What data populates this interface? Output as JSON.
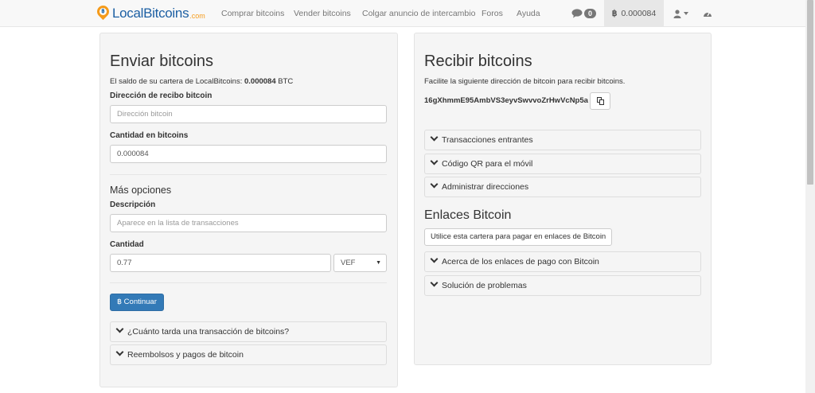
{
  "navbar": {
    "brand_name": "LocalBitcoins",
    "brand_tld": ".com",
    "links": [
      "Comprar bitcoins",
      "Vender bitcoins",
      "Colgar anuncio de intercambio",
      "Foros",
      "Ayuda"
    ],
    "chat_count": "0",
    "balance_symbol": "฿",
    "balance": "0.000084"
  },
  "send": {
    "title": "Enviar bitcoins",
    "balance_prefix": "El saldo de su cartera de LocalBitcoins: ",
    "balance_value": "0.000084",
    "balance_unit": " BTC",
    "address_label": "Dirección de recibo bitcoin",
    "address_placeholder": "Dirección bitcoin",
    "amount_label": "Cantidad en bitcoins",
    "amount_value": "0.000084",
    "more_options": "Más opciones",
    "description_label": "Descripción",
    "description_placeholder": "Aparece en la lista de transacciones",
    "quantity_label": "Cantidad",
    "quantity_value": "0.77",
    "currency": "VEF",
    "continue_label": "฿ Continuar",
    "accordion": [
      "¿Cuánto tarda una transacción de bitcoins?",
      "Reembolsos y pagos de bitcoin"
    ]
  },
  "receive": {
    "title": "Recibir bitcoins",
    "instructions": "Facilite la siguiente dirección de bitcoin para recibir bitcoins.",
    "address": "16gXhmmE95AmbVS3eyvSwvvoZrHwVcNp5a",
    "accordion": [
      "Transacciones entrantes",
      "Código QR para el móvil",
      "Administrar direcciones"
    ],
    "links_title": "Enlaces Bitcoin",
    "links_button": "Utilice esta cartera para pagar en enlaces de Bitcoin",
    "links_accordion": [
      "Acerca de los enlaces de pago con Bitcoin",
      "Solución de problemas"
    ]
  },
  "colors": {
    "brand_blue": "#1c5fa3",
    "brand_orange": "#f59b1b",
    "primary": "#337ab7"
  },
  "icons": [
    "chat-icon",
    "user-icon",
    "dashboard-icon",
    "copy-icon",
    "chevron-down-icon"
  ]
}
